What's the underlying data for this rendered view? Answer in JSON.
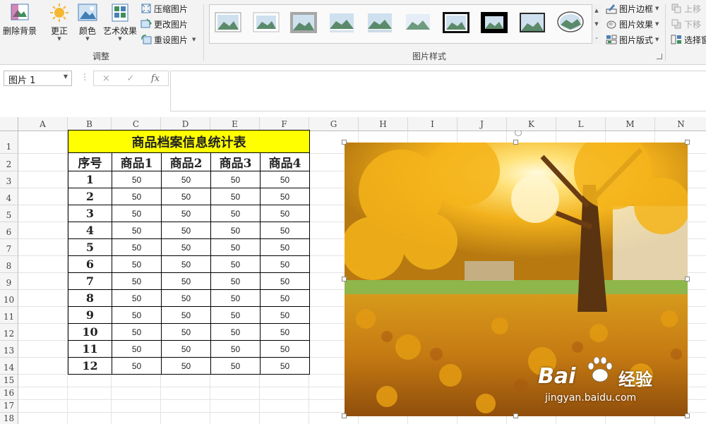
{
  "ribbon": {
    "adjust": {
      "remove_bg": "删除背景",
      "corrections": "更正",
      "color": "颜色",
      "artistic": "艺术效果",
      "compress": "压缩图片",
      "change": "更改图片",
      "reset": "重设图片",
      "group_label": "调整"
    },
    "styles": {
      "group_label": "图片样式",
      "border": "图片边框",
      "effects": "图片效果",
      "layout": "图片版式"
    },
    "arrange": {
      "bring_forward": "上移",
      "send_backward": "下移",
      "selection_pane": "选择窗"
    }
  },
  "formula_bar": {
    "name_box": "图片 1",
    "cancel": "×",
    "enter": "✓",
    "fx": "fx",
    "content": ""
  },
  "sheet": {
    "columns": [
      "A",
      "B",
      "C",
      "D",
      "E",
      "F",
      "G",
      "H",
      "I",
      "J",
      "K",
      "L",
      "M",
      "N"
    ],
    "rows": [
      "1",
      "2",
      "3",
      "4",
      "5",
      "6",
      "7",
      "8",
      "9",
      "10",
      "11",
      "12",
      "13",
      "14",
      "15",
      "16",
      "17",
      "18"
    ],
    "table": {
      "title": "商品档案信息统计表",
      "headers": [
        "序号",
        "商品1",
        "商品2",
        "商品3",
        "商品4"
      ],
      "rows": [
        [
          "1",
          "50",
          "50",
          "50",
          "50"
        ],
        [
          "2",
          "50",
          "50",
          "50",
          "50"
        ],
        [
          "3",
          "50",
          "50",
          "50",
          "50"
        ],
        [
          "4",
          "50",
          "50",
          "50",
          "50"
        ],
        [
          "5",
          "50",
          "50",
          "50",
          "50"
        ],
        [
          "6",
          "50",
          "50",
          "50",
          "50"
        ],
        [
          "7",
          "50",
          "50",
          "50",
          "50"
        ],
        [
          "8",
          "50",
          "50",
          "50",
          "50"
        ],
        [
          "9",
          "50",
          "50",
          "50",
          "50"
        ],
        [
          "10",
          "50",
          "50",
          "50",
          "50"
        ],
        [
          "11",
          "50",
          "50",
          "50",
          "50"
        ],
        [
          "12",
          "50",
          "50",
          "50",
          "50"
        ]
      ]
    }
  },
  "picture": {
    "watermark_brand": "Bai",
    "watermark_cn": "经验",
    "watermark_url": "jingyan.baidu.com"
  }
}
